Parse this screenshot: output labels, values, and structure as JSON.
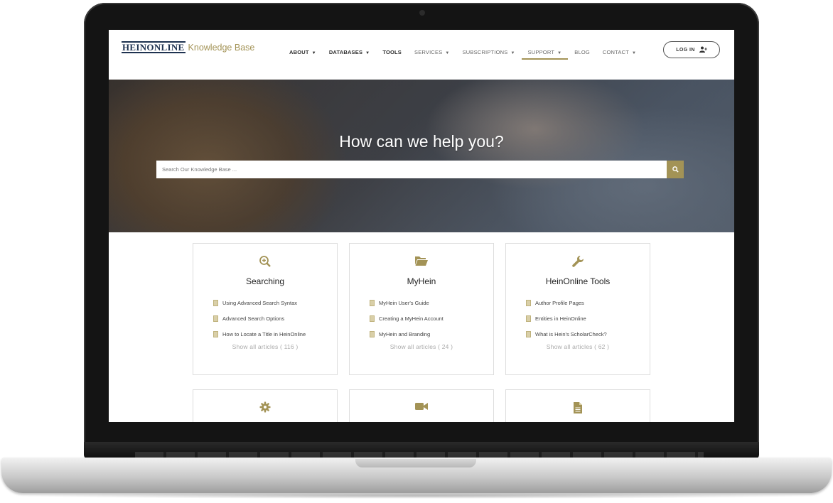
{
  "brand": {
    "logo_mark": "HEINONLINE",
    "logo_text": "Knowledge Base"
  },
  "nav": {
    "items": [
      {
        "label": "ABOUT",
        "caret": true
      },
      {
        "label": "DATABASES",
        "caret": true
      },
      {
        "label": "TOOLS",
        "caret": false
      },
      {
        "label": "SERVICES",
        "caret": true
      },
      {
        "label": "SUBSCRIPTIONS",
        "caret": true
      },
      {
        "label": "SUPPORT",
        "caret": true
      },
      {
        "label": "BLOG",
        "caret": false
      },
      {
        "label": "CONTACT",
        "caret": true
      }
    ],
    "caret_glyph": "▼",
    "login_label": "LOG IN",
    "active_item": "SUPPORT"
  },
  "hero": {
    "title": "How can we help you?",
    "search_placeholder": "Search Our Knowledge Base ..."
  },
  "cards": [
    {
      "icon": "zoom-in-icon",
      "title": "Searching",
      "articles": [
        "Using Advanced Search Syntax",
        "Advanced Search Options",
        "How to Locate a Title in HeinOnline"
      ],
      "show_all": "Show all articles ( 116 )"
    },
    {
      "icon": "folder-open-icon",
      "title": "MyHein",
      "articles": [
        "MyHein User's Guide",
        "Creating a MyHein Account",
        "MyHein and Branding"
      ],
      "show_all": "Show all articles ( 24 )"
    },
    {
      "icon": "wrench-icon",
      "title": "HeinOnline Tools",
      "articles": [
        "Author Profile Pages",
        "Entities in HeinOnline",
        "What is Hein's ScholarCheck?"
      ],
      "show_all": "Show all articles ( 62 )"
    }
  ],
  "lower_cards": [
    {
      "icon": "gear-icon"
    },
    {
      "icon": "video-camera-icon"
    },
    {
      "icon": "document-icon"
    }
  ],
  "colors": {
    "accent": "#a39356",
    "brand_navy": "#1e3250"
  }
}
